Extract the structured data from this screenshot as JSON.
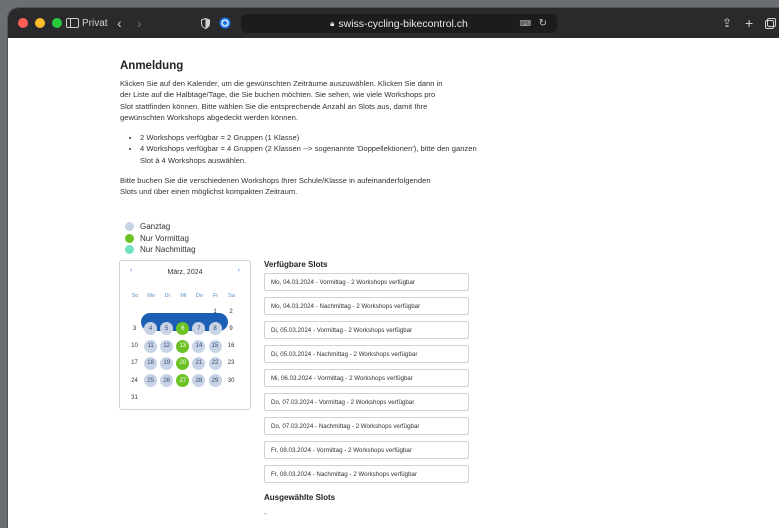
{
  "browser": {
    "profile_label": "Privat",
    "url": "swiss-cycling-bikecontrol.ch"
  },
  "page": {
    "heading": "Anmeldung",
    "paragraph1_lines": [
      "Klicken Sie auf den Kalender, um die gewünschten Zeiträume auszuwählen. Klicken Sie dann in",
      "der Liste auf die Halbtage/Tage, die Sie buchen möchten. Sie sehen, wie viele Workshops pro",
      "Slot stattfinden können. Bitte wählen Sie die entsprechende Anzahl an Slots aus, damit Ihre",
      "gewünschten Workshops abgedeckt werden können."
    ],
    "bullets": [
      "2 Workshops verfügbar = 2 Gruppen (1 Klasse)",
      "4 Workshops verfügbar = 4 Gruppen (2 Klassen --> sogenannte 'Doppellektionen'), bitte den ganzen Slot à 4 Workshops auswählen."
    ],
    "paragraph2_lines": [
      "Bitte buchen Sie die verschiedenen Workshops Ihrer Schule/Klasse in aufeinanderfolgenden",
      "Slots und über einen möglichst kompakten Zeitraum."
    ]
  },
  "legend": [
    {
      "label": "Ganztag",
      "color": "#c8d3e6"
    },
    {
      "label": "Nur Vormittag",
      "color": "#6cc224"
    },
    {
      "label": "Nur Nachmittag",
      "color": "#74e0c4"
    }
  ],
  "calendar": {
    "month_title": "März, 2024",
    "prev": "‹",
    "next": "›",
    "weekdays": [
      "So",
      "Mo",
      "Di",
      "Mi",
      "Do",
      "Fr",
      "Sa"
    ],
    "weeks": [
      [
        "",
        "",
        "",
        "",
        "",
        "1",
        "2"
      ],
      [
        "3",
        "4",
        "5",
        "6",
        "7",
        "8",
        "9"
      ],
      [
        "10",
        "11",
        "12",
        "13",
        "14",
        "15",
        "16"
      ],
      [
        "17",
        "18",
        "19",
        "20",
        "21",
        "22",
        "23"
      ],
      [
        "24",
        "25",
        "26",
        "27",
        "28",
        "29",
        "30"
      ],
      [
        "31",
        "",
        "",
        "",
        "",
        "",
        ""
      ]
    ],
    "ganztag_days": [
      "4",
      "5",
      "7",
      "8",
      "11",
      "12",
      "14",
      "15",
      "18",
      "19",
      "21",
      "22",
      "25",
      "26",
      "28",
      "29"
    ],
    "vormittag_days": [
      "6",
      "13",
      "20",
      "27"
    ],
    "selected_week": [
      "4",
      "5",
      "6",
      "7",
      "8"
    ]
  },
  "slots": {
    "title": "Verfügbare Slots",
    "items": [
      "Mo, 04.03.2024 - Vormittag - 2 Workshops verfügbar",
      "Mo, 04.03.2024 - Nachmittag - 2 Workshops verfügbar",
      "Di, 05.03.2024 - Vormittag - 2 Workshops verfügbar",
      "Di, 05.03.2024 - Nachmittag - 2 Workshops verfügbar",
      "Mi, 06.03.2024 - Vormittag - 2 Workshops verfügbar",
      "Do, 07.03.2024 - Vormittag - 2 Workshops verfügbar",
      "Do, 07.03.2024 - Nachmittag - 2 Workshops verfügbar",
      "Fr, 08.03.2024 - Vormittag - 2 Workshops verfügbar",
      "Fr, 08.03.2024 - Nachmittag - 2 Workshops verfügbar"
    ]
  },
  "selected": {
    "title": "Ausgewählte Slots",
    "value": "-"
  }
}
